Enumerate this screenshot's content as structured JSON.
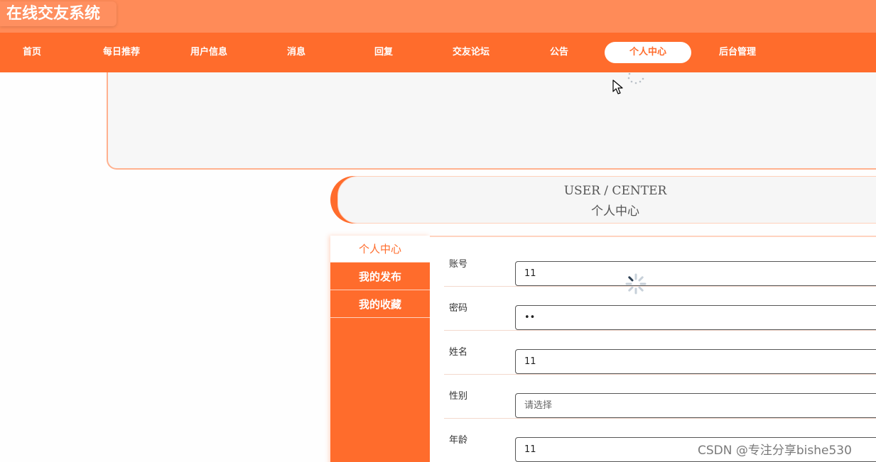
{
  "header": {
    "site_title": "在线交友系统"
  },
  "nav": {
    "items": [
      {
        "label": "首页",
        "center": 45
      },
      {
        "label": "每日推荐",
        "center": 171
      },
      {
        "label": "用户信息",
        "center": 294
      },
      {
        "label": "消息",
        "center": 417
      },
      {
        "label": "回复",
        "center": 540
      },
      {
        "label": "交友论坛",
        "center": 663
      },
      {
        "label": "公告",
        "center": 787
      },
      {
        "label": "个人中心",
        "center": 912,
        "active": true
      },
      {
        "label": "后台管理",
        "center": 1038
      }
    ]
  },
  "section": {
    "title_en": "USER / CENTER",
    "title_cn": "个人中心"
  },
  "side_menu": {
    "items": [
      {
        "label": "个人中心",
        "active": true
      },
      {
        "label": "我的发布"
      },
      {
        "label": "我的收藏"
      }
    ]
  },
  "form": {
    "fields": [
      {
        "label": "账号",
        "value": "11",
        "placeholder": ""
      },
      {
        "label": "密码",
        "value": "••",
        "placeholder": ""
      },
      {
        "label": "姓名",
        "value": "11",
        "placeholder": ""
      },
      {
        "label": "性别",
        "value": "",
        "placeholder": "请选择"
      },
      {
        "label": "年龄",
        "value": "11",
        "placeholder": ""
      }
    ]
  },
  "watermark": "CSDN @专注分享bishe530",
  "colors": {
    "accent": "#ff6c2c",
    "topbar": "#ff8b58",
    "panel_bg": "#f7f7f7"
  }
}
